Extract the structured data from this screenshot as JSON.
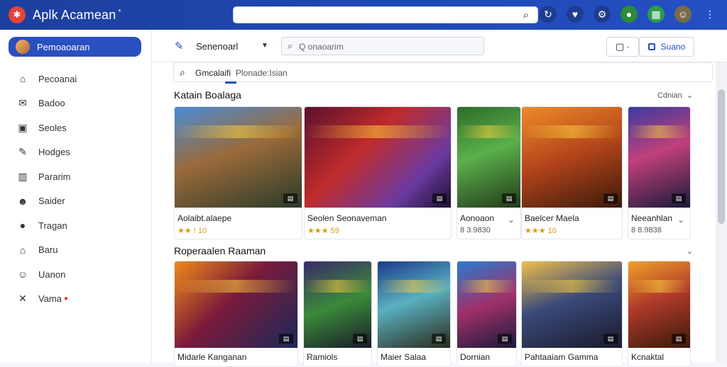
{
  "app": {
    "title": "Aplk Acamean",
    "title_mark": "*"
  },
  "colors": {
    "brand": "#2350c4",
    "header": "#1d3f9e",
    "star": "#f3b51b"
  },
  "top_icons": [
    {
      "name": "refresh-icon",
      "glyph": "↻",
      "bg": "#1f3c90"
    },
    {
      "name": "heart-icon",
      "glyph": "♥",
      "bg": "#1f3c90"
    },
    {
      "name": "settings-icon",
      "glyph": "⚙",
      "bg": "#1f3c90"
    },
    {
      "name": "notification-icon",
      "glyph": "●",
      "bg": "#2e8b3a"
    },
    {
      "name": "app-grid-icon",
      "glyph": "▦",
      "bg": "#2e9a4a"
    },
    {
      "name": "user-avatar-icon",
      "glyph": "☺",
      "bg": "#7a6a4a"
    },
    {
      "name": "more-icon",
      "glyph": "⋮",
      "bg": "transparent"
    }
  ],
  "sidebar": {
    "profile_label": "Pemoaoaran",
    "items": [
      {
        "label": "Pecoanai",
        "icon": "⌂",
        "name": "home-icon"
      },
      {
        "label": "Badoo",
        "icon": "✉",
        "name": "tag-icon"
      },
      {
        "label": "Seoles",
        "icon": "▣",
        "name": "list-icon"
      },
      {
        "label": "Hodges",
        "icon": "✎",
        "name": "edit-icon"
      },
      {
        "label": "Pararim",
        "icon": "▥",
        "name": "chart-icon"
      },
      {
        "label": "Saider",
        "icon": "☻",
        "name": "person-icon"
      },
      {
        "label": "Tragan",
        "icon": "●",
        "name": "location-icon"
      },
      {
        "label": "Baru",
        "icon": "⌂",
        "name": "store-icon"
      },
      {
        "label": "Uanon",
        "icon": "☺",
        "name": "chat-icon"
      },
      {
        "label": "Vama",
        "icon": "✕",
        "name": "close-box-icon",
        "badge": "●"
      }
    ]
  },
  "subbar": {
    "label": "Senenoarl",
    "search_placeholder": "Q onaoarim",
    "button_label": "Suano"
  },
  "inner_search": {
    "term": "Gmcalaifi",
    "suggestion": "Plonade:Isian"
  },
  "sections": [
    {
      "title": "Katain Boalaga",
      "link": "Cdnian",
      "link_icon": "⌄",
      "cards": [
        {
          "name": "Aolaibt.alaepe",
          "rating_text": "★★ ! 10",
          "more": "",
          "grad": "linear-gradient(160deg,#4a8cd6 0%,#9a6a3a 45%,#2a3a2a 100%)"
        },
        {
          "name": "Seolen Seonaveman",
          "rating_text": "★★★ 59",
          "more": "",
          "grad": "linear-gradient(135deg,#5a1030 0%,#c02b2b 40%,#6a3aa0 75%,#1a1030 100%)"
        },
        {
          "name": "Aonoaon",
          "rating_text": "8 3.9830",
          "more": "⌄",
          "grad": "linear-gradient(160deg,#2d6b2a 0%,#5ab04a 45%,#233a1a 100%)"
        },
        {
          "name": "Baelcer Maela",
          "rating_text": "★★★ 10",
          "more": "",
          "grad": "linear-gradient(160deg,#f08a2a 0%,#b0431a 50%,#3a1a0a 100%)"
        },
        {
          "name": "Neeanhlan",
          "rating_text": "8 8.9838",
          "more": "⌄",
          "grad": "linear-gradient(160deg,#3a3aa0 0%,#c0407a 45%,#1a1a3a 100%)"
        }
      ]
    },
    {
      "title": "Roperaalen Raaman",
      "link": "",
      "link_icon": "⌄",
      "cards": [
        {
          "name": "Midarle Kanganan",
          "rating_text": "",
          "more": "",
          "grad": "linear-gradient(135deg,#f08a1a 0%,#7a1a3a 45%,#1a2a5a 100%)"
        },
        {
          "name": "Ramiols",
          "rating_text": "",
          "more": "",
          "grad": "linear-gradient(160deg,#3a2a6a 0%,#3a8a3a 50%,#1a1a2a 100%)"
        },
        {
          "name": "Maier Salaa",
          "rating_text": "",
          "more": "",
          "grad": "linear-gradient(160deg,#1a3a8a 0%,#5ab0c0 45%,#2a2a1a 100%)"
        },
        {
          "name": "Dornian",
          "rating_text": "",
          "more": "",
          "grad": "linear-gradient(160deg,#2a7ad0 0%,#a0306a 50%,#1a1a3a 100%)"
        },
        {
          "name": "Pahtaaiam Gamma",
          "rating_text": "",
          "more": "",
          "grad": "linear-gradient(160deg,#f0c04a 0%,#3a4a7a 45%,#1a1a2a 100%)"
        },
        {
          "name": "Kcnaktal",
          "rating_text": "",
          "more": "",
          "grad": "linear-gradient(160deg,#f0a02a 0%,#b03a2a 45%,#3a1a0a 100%)"
        }
      ]
    }
  ]
}
